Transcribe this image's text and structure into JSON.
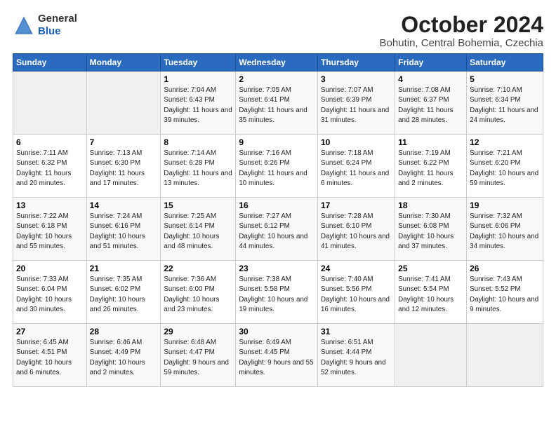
{
  "header": {
    "logo_general": "General",
    "logo_blue": "Blue",
    "title": "October 2024",
    "subtitle": "Bohutin, Central Bohemia, Czechia"
  },
  "columns": [
    "Sunday",
    "Monday",
    "Tuesday",
    "Wednesday",
    "Thursday",
    "Friday",
    "Saturday"
  ],
  "weeks": [
    [
      {
        "num": "",
        "info": ""
      },
      {
        "num": "",
        "info": ""
      },
      {
        "num": "1",
        "info": "Sunrise: 7:04 AM\nSunset: 6:43 PM\nDaylight: 11 hours and 39 minutes."
      },
      {
        "num": "2",
        "info": "Sunrise: 7:05 AM\nSunset: 6:41 PM\nDaylight: 11 hours and 35 minutes."
      },
      {
        "num": "3",
        "info": "Sunrise: 7:07 AM\nSunset: 6:39 PM\nDaylight: 11 hours and 31 minutes."
      },
      {
        "num": "4",
        "info": "Sunrise: 7:08 AM\nSunset: 6:37 PM\nDaylight: 11 hours and 28 minutes."
      },
      {
        "num": "5",
        "info": "Sunrise: 7:10 AM\nSunset: 6:34 PM\nDaylight: 11 hours and 24 minutes."
      }
    ],
    [
      {
        "num": "6",
        "info": "Sunrise: 7:11 AM\nSunset: 6:32 PM\nDaylight: 11 hours and 20 minutes."
      },
      {
        "num": "7",
        "info": "Sunrise: 7:13 AM\nSunset: 6:30 PM\nDaylight: 11 hours and 17 minutes."
      },
      {
        "num": "8",
        "info": "Sunrise: 7:14 AM\nSunset: 6:28 PM\nDaylight: 11 hours and 13 minutes."
      },
      {
        "num": "9",
        "info": "Sunrise: 7:16 AM\nSunset: 6:26 PM\nDaylight: 11 hours and 10 minutes."
      },
      {
        "num": "10",
        "info": "Sunrise: 7:18 AM\nSunset: 6:24 PM\nDaylight: 11 hours and 6 minutes."
      },
      {
        "num": "11",
        "info": "Sunrise: 7:19 AM\nSunset: 6:22 PM\nDaylight: 11 hours and 2 minutes."
      },
      {
        "num": "12",
        "info": "Sunrise: 7:21 AM\nSunset: 6:20 PM\nDaylight: 10 hours and 59 minutes."
      }
    ],
    [
      {
        "num": "13",
        "info": "Sunrise: 7:22 AM\nSunset: 6:18 PM\nDaylight: 10 hours and 55 minutes."
      },
      {
        "num": "14",
        "info": "Sunrise: 7:24 AM\nSunset: 6:16 PM\nDaylight: 10 hours and 51 minutes."
      },
      {
        "num": "15",
        "info": "Sunrise: 7:25 AM\nSunset: 6:14 PM\nDaylight: 10 hours and 48 minutes."
      },
      {
        "num": "16",
        "info": "Sunrise: 7:27 AM\nSunset: 6:12 PM\nDaylight: 10 hours and 44 minutes."
      },
      {
        "num": "17",
        "info": "Sunrise: 7:28 AM\nSunset: 6:10 PM\nDaylight: 10 hours and 41 minutes."
      },
      {
        "num": "18",
        "info": "Sunrise: 7:30 AM\nSunset: 6:08 PM\nDaylight: 10 hours and 37 minutes."
      },
      {
        "num": "19",
        "info": "Sunrise: 7:32 AM\nSunset: 6:06 PM\nDaylight: 10 hours and 34 minutes."
      }
    ],
    [
      {
        "num": "20",
        "info": "Sunrise: 7:33 AM\nSunset: 6:04 PM\nDaylight: 10 hours and 30 minutes."
      },
      {
        "num": "21",
        "info": "Sunrise: 7:35 AM\nSunset: 6:02 PM\nDaylight: 10 hours and 26 minutes."
      },
      {
        "num": "22",
        "info": "Sunrise: 7:36 AM\nSunset: 6:00 PM\nDaylight: 10 hours and 23 minutes."
      },
      {
        "num": "23",
        "info": "Sunrise: 7:38 AM\nSunset: 5:58 PM\nDaylight: 10 hours and 19 minutes."
      },
      {
        "num": "24",
        "info": "Sunrise: 7:40 AM\nSunset: 5:56 PM\nDaylight: 10 hours and 16 minutes."
      },
      {
        "num": "25",
        "info": "Sunrise: 7:41 AM\nSunset: 5:54 PM\nDaylight: 10 hours and 12 minutes."
      },
      {
        "num": "26",
        "info": "Sunrise: 7:43 AM\nSunset: 5:52 PM\nDaylight: 10 hours and 9 minutes."
      }
    ],
    [
      {
        "num": "27",
        "info": "Sunrise: 6:45 AM\nSunset: 4:51 PM\nDaylight: 10 hours and 6 minutes."
      },
      {
        "num": "28",
        "info": "Sunrise: 6:46 AM\nSunset: 4:49 PM\nDaylight: 10 hours and 2 minutes."
      },
      {
        "num": "29",
        "info": "Sunrise: 6:48 AM\nSunset: 4:47 PM\nDaylight: 9 hours and 59 minutes."
      },
      {
        "num": "30",
        "info": "Sunrise: 6:49 AM\nSunset: 4:45 PM\nDaylight: 9 hours and 55 minutes."
      },
      {
        "num": "31",
        "info": "Sunrise: 6:51 AM\nSunset: 4:44 PM\nDaylight: 9 hours and 52 minutes."
      },
      {
        "num": "",
        "info": ""
      },
      {
        "num": "",
        "info": ""
      }
    ]
  ]
}
